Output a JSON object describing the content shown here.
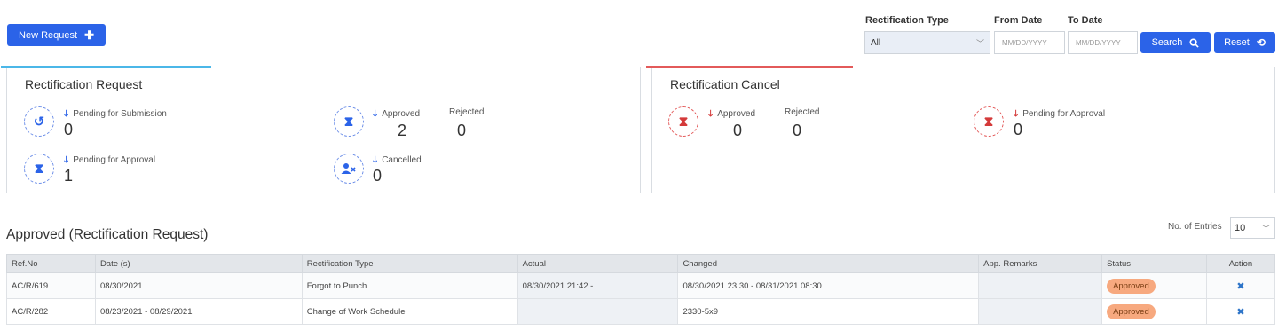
{
  "toolbar": {
    "new_request_label": "New Request",
    "new_request_icon": "plus-icon"
  },
  "filters": {
    "rectification_type_label": "Rectification Type",
    "rectification_type_value": "All",
    "from_date_label": "From Date",
    "from_date_placeholder": "MM/DD/YYYY",
    "to_date_label": "To Date",
    "to_date_placeholder": "MM/DD/YYYY",
    "search_label": "Search",
    "reset_label": "Reset"
  },
  "request_card": {
    "title": "Rectification Request",
    "accent_color": "#4bb7e8",
    "pending_submission_label": "Pending for Submission",
    "pending_submission_value": "0",
    "approved_label": "Approved",
    "approved_value": "2",
    "rejected_label": "Rejected",
    "rejected_value": "0",
    "pending_approval_label": "Pending for Approval",
    "pending_approval_value": "1",
    "cancelled_label": "Cancelled",
    "cancelled_value": "0"
  },
  "cancel_card": {
    "title": "Rectification Cancel",
    "accent_color": "#e35a5a",
    "approved_label": "Approved",
    "approved_value": "0",
    "rejected_label": "Rejected",
    "rejected_value": "0",
    "pending_approval_label": "Pending for Approval",
    "pending_approval_value": "0"
  },
  "table_section": {
    "title": "Approved (Rectification Request)",
    "entries_label": "No. of Entries",
    "entries_value": "10",
    "columns": [
      "Ref.No",
      "Date (s)",
      "Rectification Type",
      "Actual",
      "Changed",
      "App. Remarks",
      "Status",
      "Action"
    ],
    "rows": [
      {
        "ref": "AC/R/619",
        "dates": "08/30/2021",
        "type": "Forgot to Punch",
        "actual": "08/30/2021 21:42 -",
        "changed": "08/30/2021 23:30 - 08/31/2021 08:30",
        "remarks": "",
        "status": "Approved"
      },
      {
        "ref": "AC/R/282",
        "dates": "08/23/2021 - 08/29/2021",
        "type": "Change of Work Schedule",
        "actual": "",
        "changed": "2330-5x9",
        "remarks": "",
        "status": "Approved"
      }
    ]
  }
}
